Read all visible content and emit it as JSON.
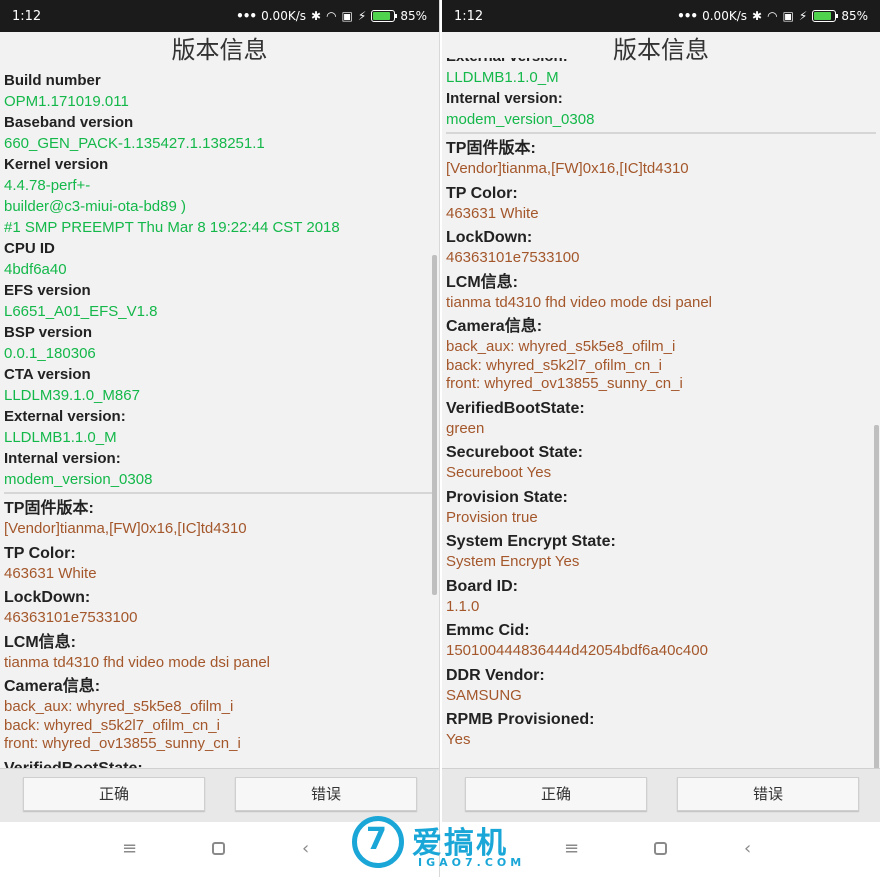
{
  "status": {
    "time": "1:12",
    "speed": "0.00K/s",
    "battery": "85%",
    "battery_level": 0.85
  },
  "title": "版本信息",
  "left": {
    "top_fields": [
      {
        "label": "Build number",
        "value": "OPM1.171019.011"
      },
      {
        "label": "Baseband version",
        "value": "660_GEN_PACK-1.135427.1.138251.1"
      },
      {
        "label": "Kernel version",
        "value": "4.4.78-perf+-\nbuilder@c3-miui-ota-bd89 )\n#1 SMP PREEMPT Thu Mar 8 19:22:44 CST 2018"
      },
      {
        "label": "CPU ID",
        "value": "4bdf6a40"
      },
      {
        "label": "EFS version",
        "value": "L6651_A01_EFS_V1.8"
      },
      {
        "label": "BSP version",
        "value": "0.0.1_180306"
      },
      {
        "label": "CTA version",
        "value": "LLDLM39.1.0_M867"
      },
      {
        "label": "External version:",
        "value": "LLDLMB1.1.0_M"
      },
      {
        "label": "Internal version:",
        "value": "modem_version_0308"
      }
    ],
    "bottom_fields": [
      {
        "label": "TP固件版本:",
        "value": "[Vendor]tianma,[FW]0x16,[IC]td4310"
      },
      {
        "label": "TP Color:",
        "value": "463631 White"
      },
      {
        "label": "LockDown:",
        "value": "46363101e7533100"
      },
      {
        "label": "LCM信息:",
        "value": "tianma td4310 fhd video mode dsi panel"
      },
      {
        "label": "Camera信息:",
        "value": "back_aux: whyred_s5k5e8_ofilm_i\nback: whyred_s5k2l7_ofilm_cn_i\nfront: whyred_ov13855_sunny_cn_i"
      },
      {
        "label": "VerifiedBootState:",
        "value": ""
      }
    ]
  },
  "right": {
    "top_fields": [
      {
        "label": "External version:",
        "value": "LLDLMB1.1.0_M"
      },
      {
        "label": "Internal version:",
        "value": "modem_version_0308"
      }
    ],
    "bottom_fields": [
      {
        "label": "TP固件版本:",
        "value": "[Vendor]tianma,[FW]0x16,[IC]td4310"
      },
      {
        "label": "TP Color:",
        "value": "463631 White"
      },
      {
        "label": "LockDown:",
        "value": "46363101e7533100"
      },
      {
        "label": "LCM信息:",
        "value": "tianma td4310 fhd video mode dsi panel"
      },
      {
        "label": "Camera信息:",
        "value": "back_aux: whyred_s5k5e8_ofilm_i\nback: whyred_s5k2l7_ofilm_cn_i\nfront: whyred_ov13855_sunny_cn_i"
      },
      {
        "label": "VerifiedBootState:",
        "value": "green"
      },
      {
        "label": "Secureboot State:",
        "value": "Secureboot Yes"
      },
      {
        "label": "Provision State:",
        "value": "Provision true"
      },
      {
        "label": "System Encrypt State:",
        "value": "System Encrypt  Yes"
      },
      {
        "label": "Board ID:",
        "value": "1.1.0"
      },
      {
        "label": "Emmc Cid:",
        "value": "150100444836444d42054bdf6a40c400"
      },
      {
        "label": "DDR Vendor:",
        "value": "SAMSUNG"
      },
      {
        "label": "RPMB Provisioned:",
        "value": "Yes"
      }
    ]
  },
  "buttons": {
    "ok": "正确",
    "error": "错误"
  },
  "nav": {
    "menu": "≡",
    "back": "‹"
  },
  "watermark": {
    "logo": "7",
    "name": "爱搞机",
    "sub": "IGAO7.COM"
  },
  "colors": {
    "green": "#14b84a",
    "brown": "#a4572b",
    "watermark": "#1aa7d8"
  }
}
